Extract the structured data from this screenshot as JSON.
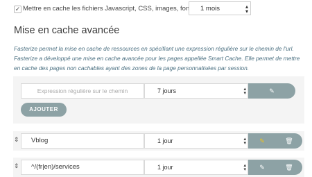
{
  "cache_all": {
    "checked": true,
    "label": "Mettre en cache les fichiers Javascript, CSS, images, fonts pour",
    "duration_value": "1 mois"
  },
  "section": {
    "title": "Mise en cache avancée",
    "description": "Fasterize permet la mise en cache de ressources en spécifiant une expression régulière sur le chemin de l'url. Fasterize a développé une mise en cache avancée pour les pages appellée Smart Cache. Elle permet de mettre en cache des pages non cachables ayant des zones de la page personnalisées par session."
  },
  "new_rule": {
    "pattern_placeholder": "Expression régulière sur le chemin",
    "duration_value": "7 jours",
    "add_label": "AJOUTER"
  },
  "rules": [
    {
      "pattern": "Vblog",
      "duration": "1 jour"
    },
    {
      "pattern": "^/(fr|en)/services",
      "duration": "1 jour"
    }
  ],
  "icons": {
    "checkbox": "check-icon",
    "select_arrows": "updown-arrow-icon",
    "edit": "pencil-icon",
    "delete": "trash-icon",
    "drag": "drag-handle-icon"
  },
  "colors": {
    "button": "#8da2a5",
    "description_text": "#4a6f80",
    "panel_bg": "#f4f4f4",
    "edit_active": "#f0c419"
  }
}
